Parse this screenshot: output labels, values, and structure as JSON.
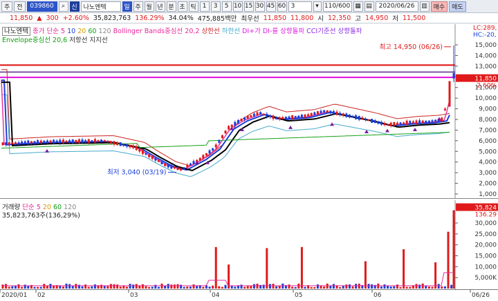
{
  "toolbar": {
    "menu_label": "주",
    "period_label": "전",
    "stock_code": "039860",
    "sin_label": "신",
    "stock_name": "나노엔텍",
    "periods": [
      "일",
      "주",
      "월",
      "년",
      "분",
      "초",
      "틱"
    ],
    "minute_buttons": [
      "1",
      "3",
      "5",
      "10",
      "15",
      "30",
      "45",
      "60"
    ],
    "count_value": "3",
    "page_value": "110/600",
    "date_value": "2020/06/26",
    "buy_label": "매수",
    "sell_label": "매도"
  },
  "quote": {
    "price": "11,850",
    "arrow": "▲",
    "change": "300",
    "change_rate": "+2.60%",
    "volume": "35,823,763",
    "volume_ratio": "136.29%",
    "turnover": "34.04%",
    "amount": "475,885백만",
    "prev_label": "최우선",
    "ask": "11,850",
    "bid": "11,800",
    "open_label": "시",
    "open": "12,350",
    "high_label": "고",
    "high": "14,950",
    "low_label": "저",
    "low": "11,500"
  },
  "price_legend": {
    "name": "나노엔텍",
    "ma_label": "종가 단순",
    "ma_periods": [
      "5",
      "10",
      "20",
      "60",
      "120"
    ],
    "bollinger": "Bollinger Bands중심선 20,2",
    "upper": "상한선",
    "lower": "하한선",
    "dmi": "DI+가 DI-를 상향돌파",
    "cci": "CCI기준선 상향돌파",
    "envelope": "Envelope중심선 20,6",
    "resistance": "저항선",
    "support": "지지선",
    "right_top": "LC:289,",
    "right_top2": "HC:-20,"
  },
  "annotations": {
    "high": "최고 14,950 (06/26)",
    "low": "최저 3,040 (03/19)"
  },
  "price_axis": {
    "ticks": [
      "15,000",
      "14,000",
      "13,000",
      "12,000",
      "11,000",
      "10,000",
      "9,000",
      "8,000",
      "7,000",
      "6,000",
      "5,000",
      "4,000",
      "3,000",
      "2,000",
      "1,000"
    ],
    "current_price": "11,850",
    "current_rate": "2.60%"
  },
  "volume_legend": {
    "title": "거래량",
    "ma_label": "단순",
    "ma_periods": [
      "5",
      "20",
      "60",
      "120"
    ],
    "current": "35,823,763주(136,29%)"
  },
  "volume_axis": {
    "ticks": [
      "30,000",
      "25,000",
      "20,000",
      "15,000",
      "10,000",
      "5,000K"
    ],
    "current": "35,824",
    "current_rate": "136.29"
  },
  "x_axis": {
    "labels": [
      "2020/01",
      "02",
      "03",
      "04",
      "05",
      "06",
      "06/26"
    ]
  },
  "colors": {
    "up": "#e01a1a",
    "down": "#1a3fd8",
    "ma5": "#e8279a",
    "ma10": "#1a3fd8",
    "ma20": "#000000",
    "resistance": "#e01a1a",
    "support": "#e01ae0",
    "bollinger_upper": "#cc2222",
    "bollinger_lower": "#44a9cc"
  },
  "chart_data": {
    "type": "candlestick",
    "ylim": [
      0,
      15500
    ],
    "price_series_approx": [
      {
        "x": "2020/01",
        "value": 5700
      },
      {
        "x": "02",
        "value": 5900
      },
      {
        "x": "03",
        "value": 5200
      },
      {
        "x": "03/19",
        "value": 3040
      },
      {
        "x": "04",
        "value": 4800
      },
      {
        "x": "04(mid)",
        "value": 8200
      },
      {
        "x": "05",
        "value": 8400
      },
      {
        "x": "06",
        "value": 7600
      },
      {
        "x": "06/26",
        "value": 11850
      }
    ],
    "high": 14950,
    "low": 3040,
    "volume_ylim": [
      0,
      36000
    ],
    "volume_last": 35824
  }
}
